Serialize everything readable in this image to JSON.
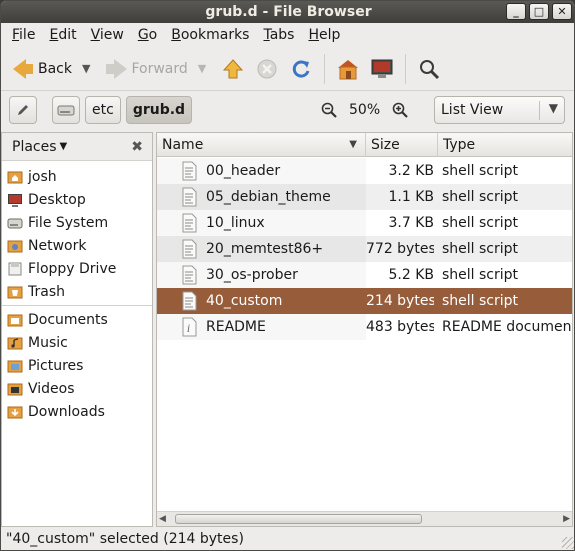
{
  "window": {
    "title": "grub.d - File Browser"
  },
  "menubar": {
    "items": [
      {
        "pre": "",
        "u": "F",
        "post": "ile"
      },
      {
        "pre": "",
        "u": "E",
        "post": "dit"
      },
      {
        "pre": "",
        "u": "V",
        "post": "iew"
      },
      {
        "pre": "",
        "u": "G",
        "post": "o"
      },
      {
        "pre": "",
        "u": "B",
        "post": "ookmarks"
      },
      {
        "pre": "",
        "u": "T",
        "post": "abs"
      },
      {
        "pre": "",
        "u": "H",
        "post": "elp"
      }
    ]
  },
  "toolbar": {
    "back_label": "Back",
    "forward_label": "Forward"
  },
  "location": {
    "crumbs": [
      "etc",
      "grub.d"
    ],
    "zoom": "50%",
    "view_mode": "List View"
  },
  "sidebar": {
    "header": "Places",
    "groups": [
      [
        {
          "label": "josh",
          "icon": "home-folder-icon"
        },
        {
          "label": "Desktop",
          "icon": "desktop-icon"
        },
        {
          "label": "File System",
          "icon": "hard-drive-icon"
        },
        {
          "label": "Network",
          "icon": "network-icon"
        },
        {
          "label": "Floppy Drive",
          "icon": "floppy-icon"
        },
        {
          "label": "Trash",
          "icon": "trash-icon"
        }
      ],
      [
        {
          "label": "Documents",
          "icon": "folder-icon"
        },
        {
          "label": "Music",
          "icon": "music-folder-icon"
        },
        {
          "label": "Pictures",
          "icon": "pictures-folder-icon"
        },
        {
          "label": "Videos",
          "icon": "videos-folder-icon"
        },
        {
          "label": "Downloads",
          "icon": "downloads-folder-icon"
        }
      ]
    ]
  },
  "filelist": {
    "columns": {
      "name": "Name",
      "size": "Size",
      "type": "Type"
    },
    "rows": [
      {
        "name": "00_header",
        "size": "3.2 KB",
        "type": "shell script",
        "icon": "script-file-icon",
        "selected": false
      },
      {
        "name": "05_debian_theme",
        "size": "1.1 KB",
        "type": "shell script",
        "icon": "script-file-icon",
        "selected": false
      },
      {
        "name": "10_linux",
        "size": "3.7 KB",
        "type": "shell script",
        "icon": "script-file-icon",
        "selected": false
      },
      {
        "name": "20_memtest86+",
        "size": "772 bytes",
        "type": "shell script",
        "icon": "script-file-icon",
        "selected": false
      },
      {
        "name": "30_os-prober",
        "size": "5.2 KB",
        "type": "shell script",
        "icon": "script-file-icon",
        "selected": false
      },
      {
        "name": "40_custom",
        "size": "214 bytes",
        "type": "shell script",
        "icon": "script-file-icon",
        "selected": true
      },
      {
        "name": "README",
        "size": "483 bytes",
        "type": "README document",
        "icon": "info-file-icon",
        "selected": false
      }
    ]
  },
  "status": {
    "text": "\"40_custom\" selected (214 bytes)"
  },
  "colors": {
    "selection": "#975c3a",
    "accent": "#e8a93c"
  }
}
